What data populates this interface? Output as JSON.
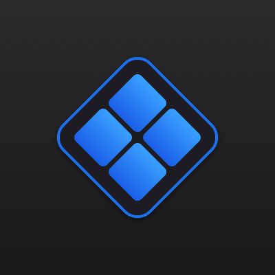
{
  "app_icon": {
    "icon_name": "diamond-grid-logo-icon",
    "colors": {
      "background_top": "#2a2a2a",
      "background_bottom": "#191919",
      "diamond_fill": "#1e1f24",
      "diamond_stroke": "#1e6ff0",
      "tile_top": "#3aa0ff",
      "tile_bottom": "#1a5fe8"
    }
  }
}
